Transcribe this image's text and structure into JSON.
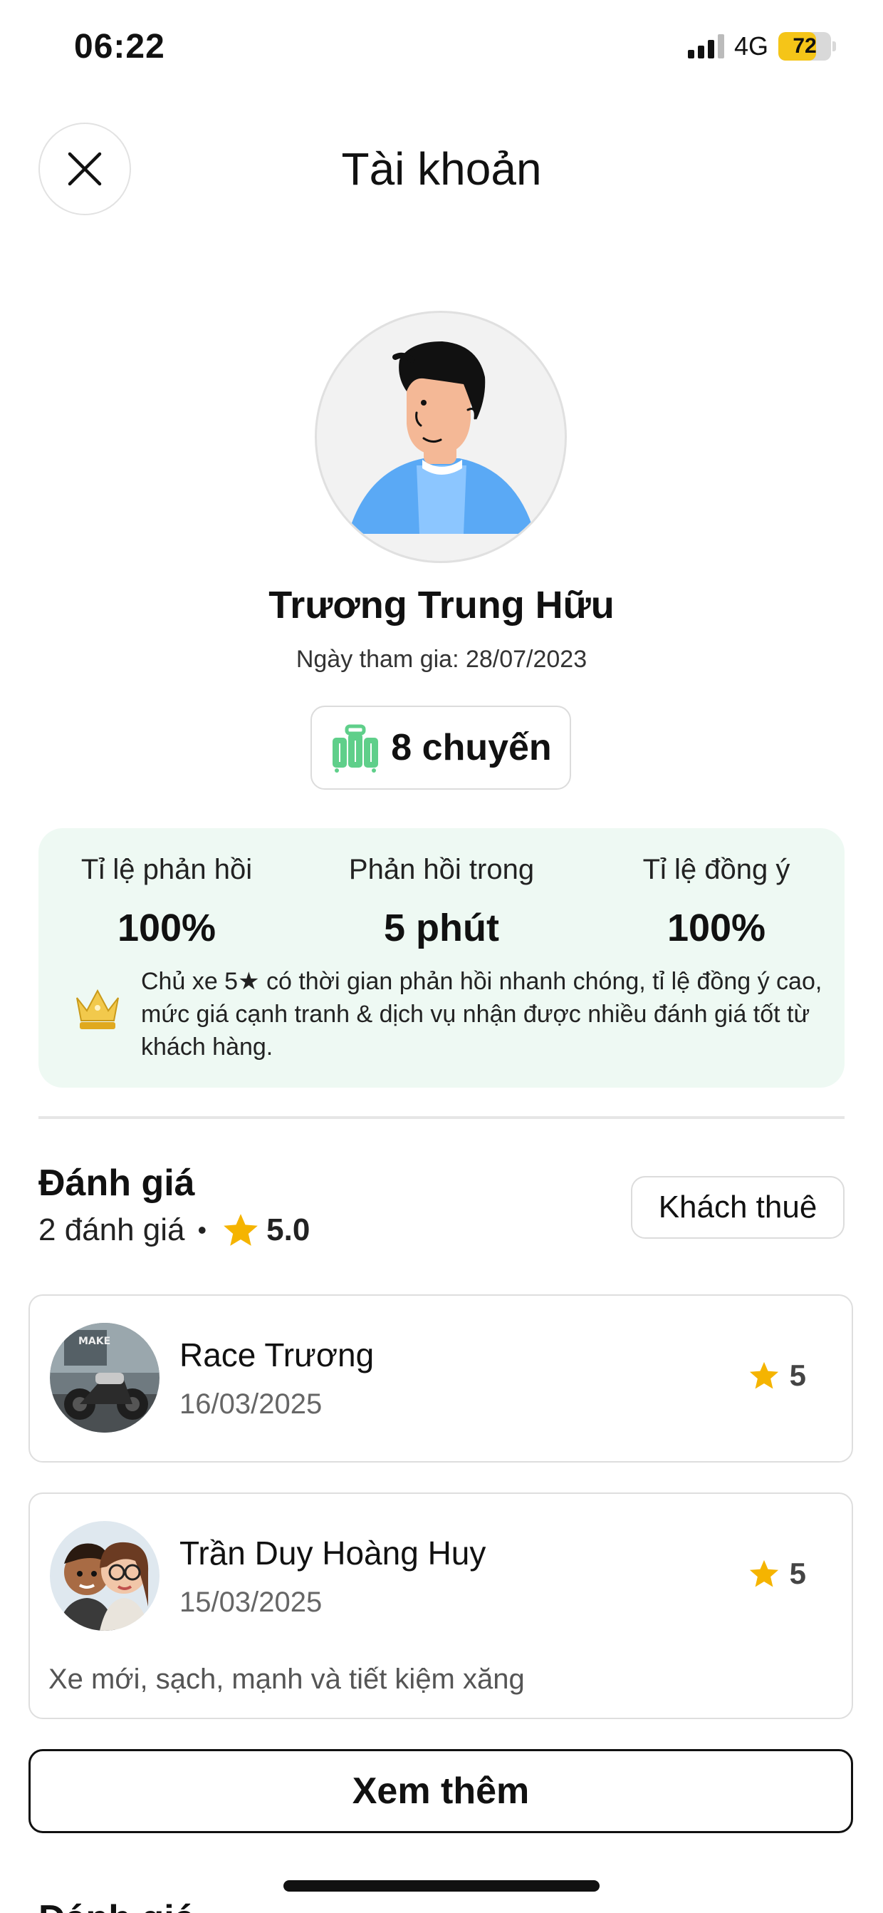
{
  "status_bar": {
    "time": "06:22",
    "network": "4G",
    "battery_level": "72",
    "battery_fraction": 0.72
  },
  "header": {
    "title": "Tài khoản"
  },
  "profile": {
    "name": "Trương Trung Hữu",
    "join_date": "Ngày tham gia: 28/07/2023",
    "trips": "8 chuyến"
  },
  "stats": {
    "items": [
      {
        "label": "Tỉ lệ phản hồi",
        "value": "100%"
      },
      {
        "label": "Phản hồi trong",
        "value": "5 phút"
      },
      {
        "label": "Tỉ lệ đồng ý",
        "value": "100%"
      }
    ],
    "note": "Chủ xe 5★ có thời gian phản hồi nhanh chóng, tỉ lệ đồng ý cao, mức giá cạnh tranh & dịch vụ nhận được nhiều đánh giá tốt từ khách hàng."
  },
  "reviews": {
    "title": "Đánh giá",
    "count": "2 đánh giá",
    "separator": "•",
    "average": "5.0",
    "filter_label": "Khách thuê",
    "items": [
      {
        "name": "Race Trương",
        "date": "16/03/2025",
        "rating": "5",
        "comment": ""
      },
      {
        "name": "Trần Duy Hoàng Huy",
        "date": "15/03/2025",
        "rating": "5",
        "comment": "Xe mới, sạch, mạnh và tiết kiệm xăng"
      }
    ],
    "more_label": "Xem thêm"
  },
  "next_section": {
    "title": "Đánh giá"
  },
  "colors": {
    "accent_green": "#5fcf8a",
    "stats_bg": "#eef9f3",
    "star": "#f5b400",
    "crown": "#e6b422"
  }
}
